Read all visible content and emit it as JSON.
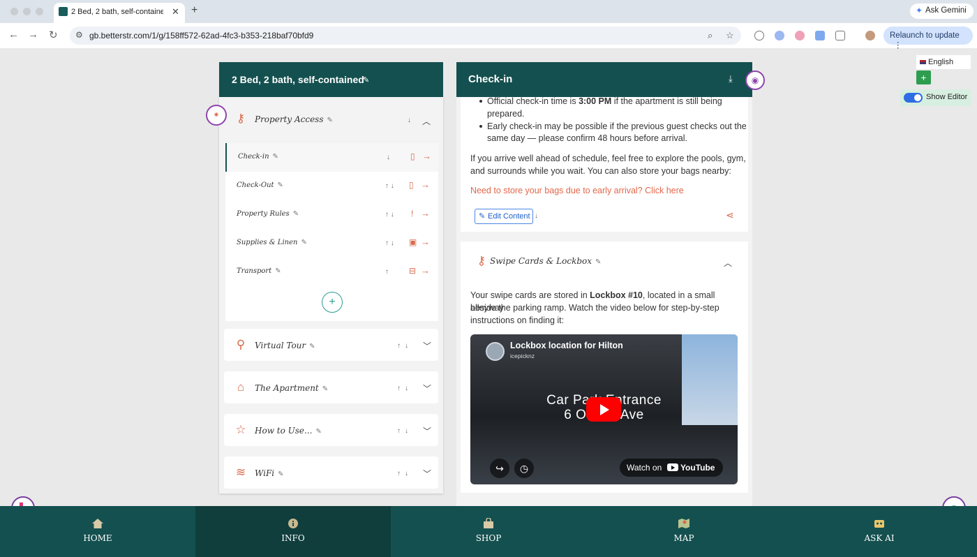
{
  "browser": {
    "tab_title": "2 Bed, 2 bath, self-contained",
    "tab_close": "✕",
    "new_tab": "+",
    "url": "gb.betterstr.com/1/g/158ff572-62ad-4fc3-b353-218baf70bfd9",
    "gemini_label": "Ask Gemini",
    "relaunch_label": "Relaunch to update"
  },
  "left_panel": {
    "title": "2 Bed, 2 bath, self-contained",
    "property_access": {
      "label": "Property Access",
      "sub_items": [
        {
          "label": "Check-in",
          "arrows": "↓"
        },
        {
          "label": "Check-Out",
          "arrows": "↑ ↓"
        },
        {
          "label": "Property Rules",
          "arrows": "↑ ↓"
        },
        {
          "label": "Supplies & Linen",
          "arrows": "↑ ↓"
        },
        {
          "label": "Transport",
          "arrows": "↑"
        }
      ]
    },
    "sections": [
      {
        "label": "Virtual Tour",
        "icon": "walking-icon"
      },
      {
        "label": "The Apartment",
        "icon": "house-icon"
      },
      {
        "label": "How to Use...",
        "icon": "star-icon"
      },
      {
        "label": "WiFi",
        "icon": "wifi-icon"
      }
    ]
  },
  "right_panel": {
    "title": "Check-in",
    "bullet1_pre": "Official check-in time is ",
    "bullet1_bold": "3:00 PM",
    "bullet1_post": " if the apartment is still being",
    "bullet1_line2": "prepared.",
    "bullet2_line1": "Early check-in may be possible if the previous guest checks out the",
    "bullet2_line2": "same day — please confirm 48 hours before arrival.",
    "para_line1": "If you arrive well ahead of schedule, feel free to explore the pools, gym,",
    "para_line2": "and surrounds while you wait. You can also store your bags nearby:",
    "link": "Need to store your bags due to early arrival? Click here",
    "edit_content": "Edit Content",
    "swipe_title": "Swipe Cards & Lockbox",
    "swipe_line1_pre": "Your swipe cards are stored in ",
    "swipe_line1_bold": "Lockbox #10",
    "swipe_line1_post": ", located in a small alleyway",
    "swipe_line2": "beside the parking ramp. Watch the video below for step-by-step",
    "swipe_line3": "instructions on finding it:"
  },
  "video": {
    "title": "Lockbox location for Hilton",
    "channel": "icepicknz",
    "overlay_line1": "Car Park Entrance",
    "overlay_line2": "6 Orakei Ave",
    "watch_on": "Watch on",
    "youtube": "YouTube"
  },
  "side_controls": {
    "language": "English",
    "add": "+",
    "show_editor": "Show Editor"
  },
  "bottom_nav": [
    {
      "label": "HOME",
      "icon": "home-icon"
    },
    {
      "label": "INFO",
      "icon": "info-icon",
      "active": true
    },
    {
      "label": "SHOP",
      "icon": "bag-icon"
    },
    {
      "label": "MAP",
      "icon": "map-icon"
    },
    {
      "label": "ASK AI",
      "icon": "robot-icon"
    }
  ],
  "colors": {
    "header_teal": "#14504f",
    "accent_orange": "#d9694a",
    "link_blue": "#1c5fcc",
    "badge_purple": "#8e44ad"
  }
}
